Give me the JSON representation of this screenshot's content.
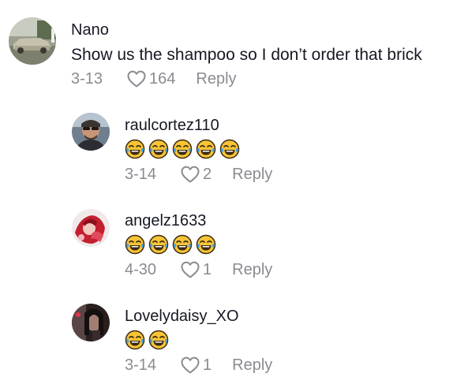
{
  "comments": [
    {
      "username": "Nano",
      "text": "Show us the shampoo so I don’t order that brick",
      "date": "3-13",
      "likes": "164",
      "reply_label": "Reply",
      "avatar_icon": "vintage-car-photo"
    },
    {
      "username": "raulcortez110",
      "emoji_count": 5,
      "emoji_icon": "face-with-tears-of-joy",
      "date": "3-14",
      "likes": "2",
      "reply_label": "Reply",
      "avatar_icon": "man-with-sunglasses-photo"
    },
    {
      "username": "angelz1633",
      "emoji_count": 4,
      "emoji_icon": "face-with-tears-of-joy",
      "date": "4-30",
      "likes": "1",
      "reply_label": "Reply",
      "avatar_icon": "red-anime-art"
    },
    {
      "username": "Lovelydaisy_XO",
      "emoji_count": 2,
      "emoji_icon": "face-with-tears-of-joy",
      "date": "3-14",
      "likes": "1",
      "reply_label": "Reply",
      "avatar_icon": "dark-selfie-photo"
    }
  ],
  "colors": {
    "text": "#161823",
    "meta": "#8a8b91",
    "emoji_face": "#f7c436",
    "emoji_tears": "#4aa3e8"
  }
}
